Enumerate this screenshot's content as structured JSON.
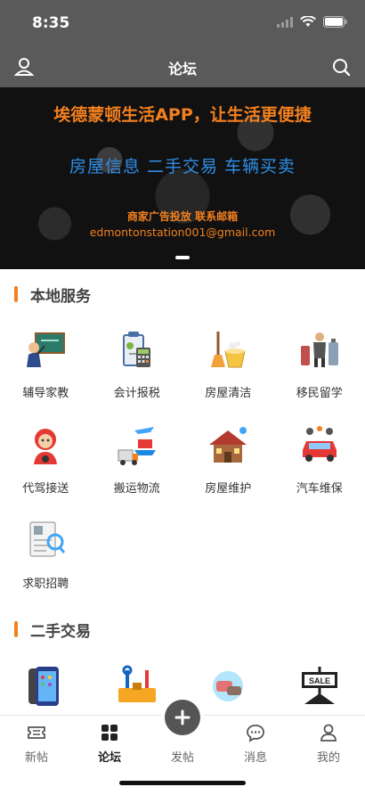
{
  "status_bar": {
    "time": "8:35"
  },
  "navbar": {
    "title": "论坛",
    "left_icon": "user-icon",
    "right_icon": "search-icon"
  },
  "banner": {
    "title": "埃德蒙顿生活APP，让生活更便捷",
    "subtitle": "房屋信息  二手交易  车辆买卖",
    "ad_line": "商家广告投放 联系邮箱",
    "email": "edmontonstation001@gmail.com"
  },
  "local_services": {
    "title": "本地服务",
    "items": [
      {
        "label": "辅导家教",
        "icon": "tutor-icon"
      },
      {
        "label": "会计报税",
        "icon": "accounting-icon"
      },
      {
        "label": "房屋清洁",
        "icon": "cleaning-icon"
      },
      {
        "label": "移民留学",
        "icon": "immigration-icon"
      },
      {
        "label": "代驾接送",
        "icon": "driver-icon"
      },
      {
        "label": "搬运物流",
        "icon": "logistics-icon"
      },
      {
        "label": "房屋维护",
        "icon": "house-repair-icon"
      },
      {
        "label": "汽车维保",
        "icon": "car-repair-icon"
      },
      {
        "label": "求职招聘",
        "icon": "job-icon"
      }
    ]
  },
  "second_hand": {
    "title": "二手交易",
    "items": [
      {
        "icon": "phone-icon"
      },
      {
        "icon": "tools-icon"
      },
      {
        "icon": "misc-goods-icon"
      },
      {
        "icon": "sale-sign-icon",
        "sign_text": "SALE"
      }
    ]
  },
  "tabbar": {
    "items": [
      {
        "label": "新帖",
        "icon": "ticket-icon"
      },
      {
        "label": "论坛",
        "icon": "grid-icon",
        "active": true
      },
      {
        "label": "发帖",
        "icon": "plus-icon"
      },
      {
        "label": "消息",
        "icon": "message-icon"
      },
      {
        "label": "我的",
        "icon": "profile-icon"
      }
    ]
  },
  "colors": {
    "accent": "#f2801f",
    "blue": "#2f8ee8",
    "header": "#5a5a5a"
  }
}
